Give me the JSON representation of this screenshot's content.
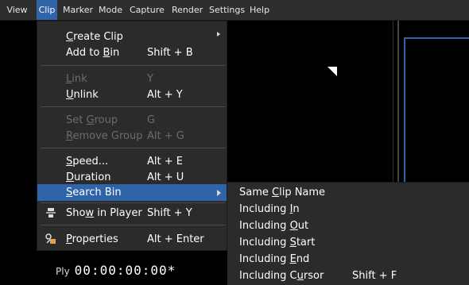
{
  "menubar": {
    "items": [
      {
        "label": "View",
        "active": false
      },
      {
        "label": "Clip",
        "active": true
      },
      {
        "label": "Marker",
        "active": false
      },
      {
        "label": "Mode",
        "active": false
      },
      {
        "label": "Capture",
        "active": false
      },
      {
        "label": "Render",
        "active": false
      },
      {
        "label": "Settings",
        "active": false
      },
      {
        "label": "Help",
        "active": false
      }
    ]
  },
  "clip_menu": {
    "create_clip": {
      "pre": "",
      "u": "C",
      "post": "reate Clip"
    },
    "add_to_bin": {
      "pre": "Add to ",
      "u": "B",
      "post": "in",
      "shortcut": "Shift + B"
    },
    "link": {
      "pre": "",
      "u": "L",
      "post": "ink",
      "shortcut": "Y"
    },
    "unlink": {
      "pre": "",
      "u": "U",
      "post": "nlink",
      "shortcut": "Alt + Y"
    },
    "set_group": {
      "pre": "Set ",
      "u": "G",
      "post": "roup",
      "shortcut": "G"
    },
    "remove_group": {
      "pre": "",
      "u": "R",
      "post": "emove Group",
      "shortcut": "Alt + G"
    },
    "speed": {
      "pre": "",
      "u": "S",
      "post": "peed...",
      "shortcut": "Alt + E"
    },
    "duration": {
      "pre": "",
      "u": "D",
      "post": "uration",
      "shortcut": "Alt + U"
    },
    "search_bin": {
      "pre": "",
      "u": "S",
      "post": "earch Bin"
    },
    "show_in_player": {
      "pre": "Sho",
      "u": "w",
      "post": " in Player",
      "shortcut": "Shift + Y"
    },
    "properties": {
      "pre": "",
      "u": "P",
      "post": "roperties",
      "shortcut": "Alt + Enter"
    }
  },
  "search_bin_submenu": {
    "same_clip_name": {
      "pre": "Same ",
      "u": "C",
      "post": "lip Name"
    },
    "including_in": {
      "pre": "Including ",
      "u": "I",
      "post": "n"
    },
    "including_out": {
      "pre": "Including ",
      "u": "O",
      "post": "ut"
    },
    "including_start": {
      "pre": "Including ",
      "u": "S",
      "post": "tart"
    },
    "including_end": {
      "pre": "Including ",
      "u": "E",
      "post": "nd"
    },
    "including_cursor": {
      "pre": "Including C",
      "u": "u",
      "post": "rsor",
      "shortcut": "Shift + F"
    }
  },
  "timecode": {
    "prefix": "Ply",
    "value": "00:00:00:00*"
  },
  "colors": {
    "highlight": "#2f64a8",
    "menu_bg": "#2b2b2b",
    "menubar_bg": "#2e2e2e",
    "disabled_text": "#6c6c6c"
  },
  "icons": {
    "show_in_player": "player-icon",
    "properties": "properties-icon",
    "submenu_arrow": "chevron-right-icon"
  }
}
